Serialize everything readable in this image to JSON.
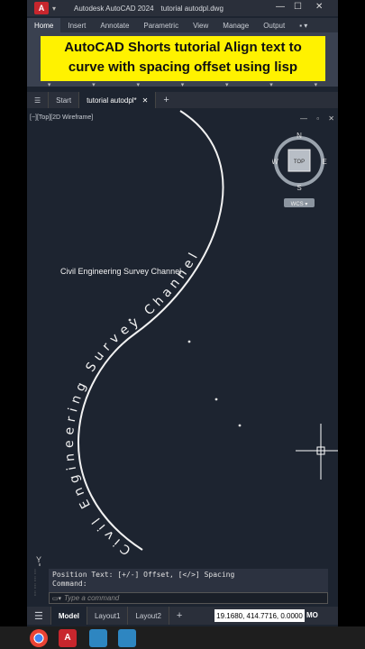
{
  "titlebar": {
    "app_letter": "A",
    "app_name": "Autodesk AutoCAD 2024",
    "file_name": "tutorial autodpl.dwg",
    "minimize": "—",
    "maximize": "☐",
    "close": "✕"
  },
  "ribbon": {
    "tabs": [
      "Home",
      "Insert",
      "Annotate",
      "Parametric",
      "View",
      "Manage",
      "Output"
    ],
    "extra": "▪ ▾"
  },
  "banner": {
    "line1": "AutoCAD Shorts tutorial Align text to",
    "line2": "curve with spacing offset using lisp"
  },
  "doc_tabs": {
    "menu": "☰",
    "start": "Start",
    "active": "tutorial autodpl*",
    "close": "✕",
    "add": "+"
  },
  "viewport": {
    "label": "[−][Top][2D Wireframe]",
    "controls": "— ▫ ✕",
    "plain_text": "Civil Engineering Survey Channel",
    "curve_text": "Civil Engineering Survey Channel",
    "y_axis": "Y"
  },
  "navcube": {
    "n": "N",
    "s": "S",
    "e": "E",
    "w": "W",
    "top": "TOP",
    "wcs": "WCS ▾"
  },
  "command": {
    "line1": "Position Text: [+/-] Offset, [</>] Spacing",
    "line2": "Command:",
    "placeholder": "Type a command"
  },
  "status": {
    "menu": "☰",
    "model": "Model",
    "layout1": "Layout1",
    "layout2": "Layout2",
    "add": "+",
    "coords": "19.1680, 414.7716, 0.0000",
    "mode": "MO"
  },
  "colors": {
    "canvas": "#1d2430",
    "banner": "#fff200",
    "accent": "#c8262d"
  }
}
